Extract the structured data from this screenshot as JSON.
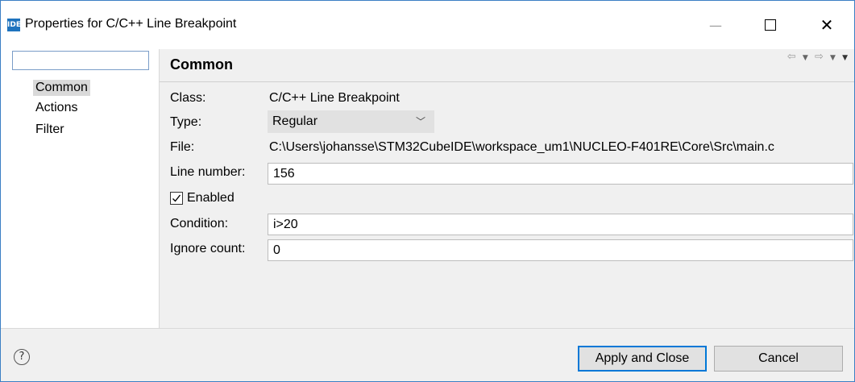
{
  "window": {
    "badge": "IDE",
    "title": "Properties for C/C++ Line Breakpoint",
    "controls": {
      "minimize": "—",
      "close": "✕"
    }
  },
  "tree": {
    "filter_value": "",
    "items": [
      {
        "label": "Common",
        "selected": true
      },
      {
        "label": "Actions",
        "selected": false
      },
      {
        "label": "Filter",
        "selected": false
      }
    ]
  },
  "page": {
    "title": "Common",
    "nav": {
      "back": "⇦",
      "forward": "⇨",
      "dropdown": "▼"
    },
    "class_label": "Class:",
    "class_value": "C/C++ Line Breakpoint",
    "type_label": "Type:",
    "type_value": "Regular",
    "file_label": "File:",
    "file_value": "C:\\Users\\johansse\\STM32CubeIDE\\workspace_um1\\NUCLEO-F401RE\\Core\\Src\\main.c",
    "line_label": "Line number:",
    "line_value": "156",
    "enabled_label": "Enabled",
    "enabled_checked": true,
    "condition_label": "Condition:",
    "condition_value": "i>20",
    "ignore_label": "Ignore count:",
    "ignore_value": "0"
  },
  "footer": {
    "help": "?",
    "apply_label": "Apply and Close",
    "cancel_label": "Cancel"
  },
  "colors": {
    "accent": "#0078d7",
    "window_border": "#3c7fc4",
    "badge": "#1e73be",
    "background": "#f0f0f0"
  },
  "icons": {
    "app": "ide-badge-icon",
    "back": "arrow-left-icon",
    "forward": "arrow-right-icon",
    "menu": "chevron-down-icon",
    "help": "help-icon",
    "check": "checkmark-icon"
  }
}
